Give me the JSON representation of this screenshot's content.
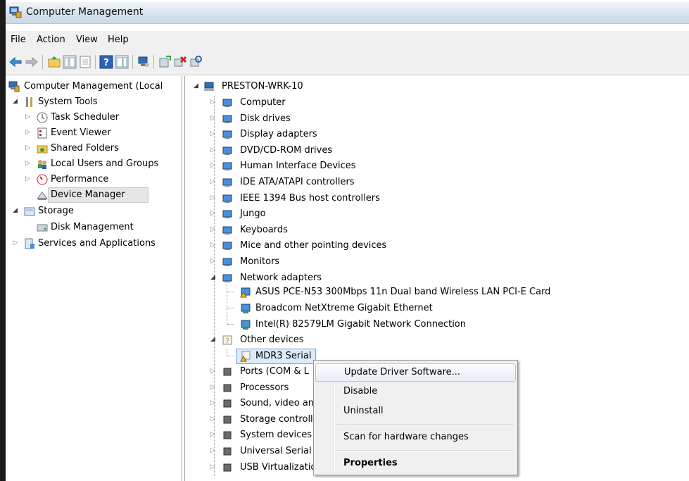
{
  "window": {
    "title": "Computer Management"
  },
  "menubar": {
    "items": [
      "File",
      "Action",
      "View",
      "Help"
    ]
  },
  "left_tree": {
    "root": "Computer Management (Local",
    "system_tools": "System Tools",
    "task_scheduler": "Task Scheduler",
    "event_viewer": "Event Viewer",
    "shared_folders": "Shared Folders",
    "local_users": "Local Users and Groups",
    "performance": "Performance",
    "device_manager": "Device Manager",
    "storage": "Storage",
    "disk_management": "Disk Management",
    "services": "Services and Applications"
  },
  "device_tree": {
    "host": "PRESTON-WRK-10",
    "categories": [
      "Computer",
      "Disk drives",
      "Display adapters",
      "DVD/CD-ROM drives",
      "Human Interface Devices",
      "IDE ATA/ATAPI controllers",
      "IEEE 1394 Bus host controllers",
      "Jungo",
      "Keyboards",
      "Mice and other pointing devices",
      "Monitors",
      "Network adapters"
    ],
    "network_children": [
      "ASUS PCE-N53 300Mbps 11n Dual band Wireless LAN PCI-E Card",
      "Broadcom NetXtreme Gigabit Ethernet",
      "Intel(R) 82579LM Gigabit Network Connection"
    ],
    "other_devices": "Other devices",
    "mdr3": "MDR3 Serial",
    "more_categories": [
      "Ports (COM & L",
      "Processors",
      "Sound, video an",
      "Storage controll",
      "System devices",
      "Universal Serial I",
      "USB Virtualizatio"
    ]
  },
  "context_menu": {
    "update": "Update Driver Software...",
    "disable": "Disable",
    "uninstall": "Uninstall",
    "scan": "Scan for hardware changes",
    "properties": "Properties"
  },
  "colors": {
    "selection": "#dceafb",
    "titlebar": "#d6e0ec",
    "menu_bg": "#f0f0f0"
  }
}
